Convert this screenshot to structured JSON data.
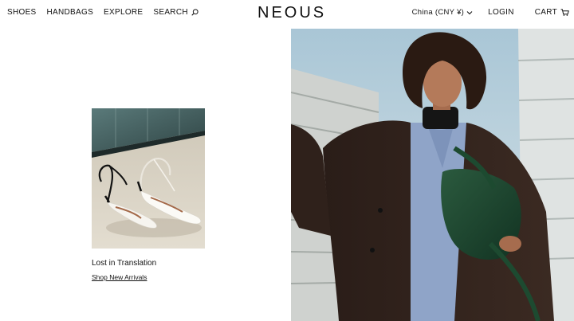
{
  "header": {
    "logo": "NEOUS",
    "nav": {
      "shoes": "SHOES",
      "handbags": "HANDBAGS",
      "explore": "EXPLORE",
      "search": "SEARCH"
    },
    "currency": "China (CNY ¥)",
    "login": "LOGIN",
    "cart": "CART"
  },
  "feature": {
    "title": "Lost in Translation",
    "cta": "Shop New Arrivals"
  },
  "icons": {
    "search": "search-icon",
    "currency_dropdown": "chevron-down-icon",
    "cart": "cart-icon"
  }
}
